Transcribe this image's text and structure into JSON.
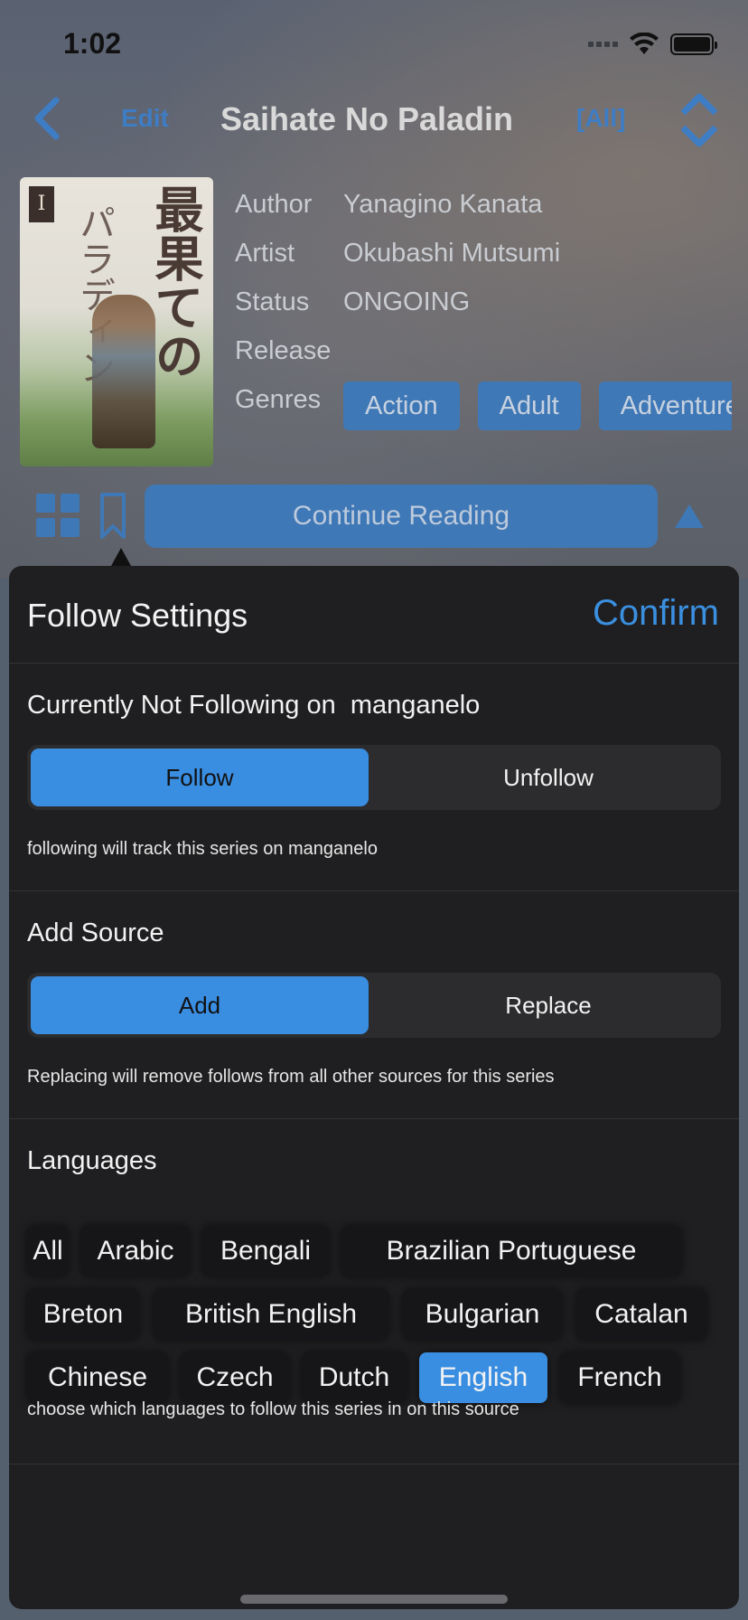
{
  "status_bar": {
    "time": "1:02"
  },
  "nav": {
    "edit_label": "Edit",
    "title": "Saihate No Paladin",
    "all_label": "[All]"
  },
  "cover": {
    "volume": "I",
    "title_kanji": "最果ての",
    "title_kanji2": "パラディン"
  },
  "info": {
    "author_label": "Author",
    "author": "Yanagino Kanata",
    "artist_label": "Artist",
    "artist": "Okubashi Mutsumi",
    "status_label": "Status",
    "status": "ONGOING",
    "release_label": "Release",
    "genres_label": "Genres",
    "genres": [
      "Action",
      "Adult",
      "Adventure"
    ]
  },
  "actions": {
    "continue_label": "Continue Reading"
  },
  "sheet": {
    "title": "Follow Settings",
    "confirm_label": "Confirm",
    "follow_section": {
      "title": "Currently Not Following on  manganelo",
      "options": [
        "Follow",
        "Unfollow"
      ],
      "selected": "Follow",
      "note": "following will track this series on manganelo"
    },
    "source_section": {
      "title": "Add Source",
      "options": [
        "Add",
        "Replace"
      ],
      "selected": "Add",
      "note": "Replacing will remove follows from all other sources for this series"
    },
    "languages_section": {
      "title": "Languages",
      "languages": [
        "All",
        "Arabic",
        "Bengali",
        "Brazilian Portuguese",
        "Breton",
        "British English",
        "Bulgarian",
        "Catalan",
        "Chinese",
        "Czech",
        "Dutch",
        "English",
        "French"
      ],
      "selected": "English",
      "note": "choose which languages to follow this series in on this source"
    }
  },
  "colors": {
    "accent": "#3a8ee2",
    "dim_accent": "#3f78b6",
    "sheet_bg": "#1f1f21"
  }
}
